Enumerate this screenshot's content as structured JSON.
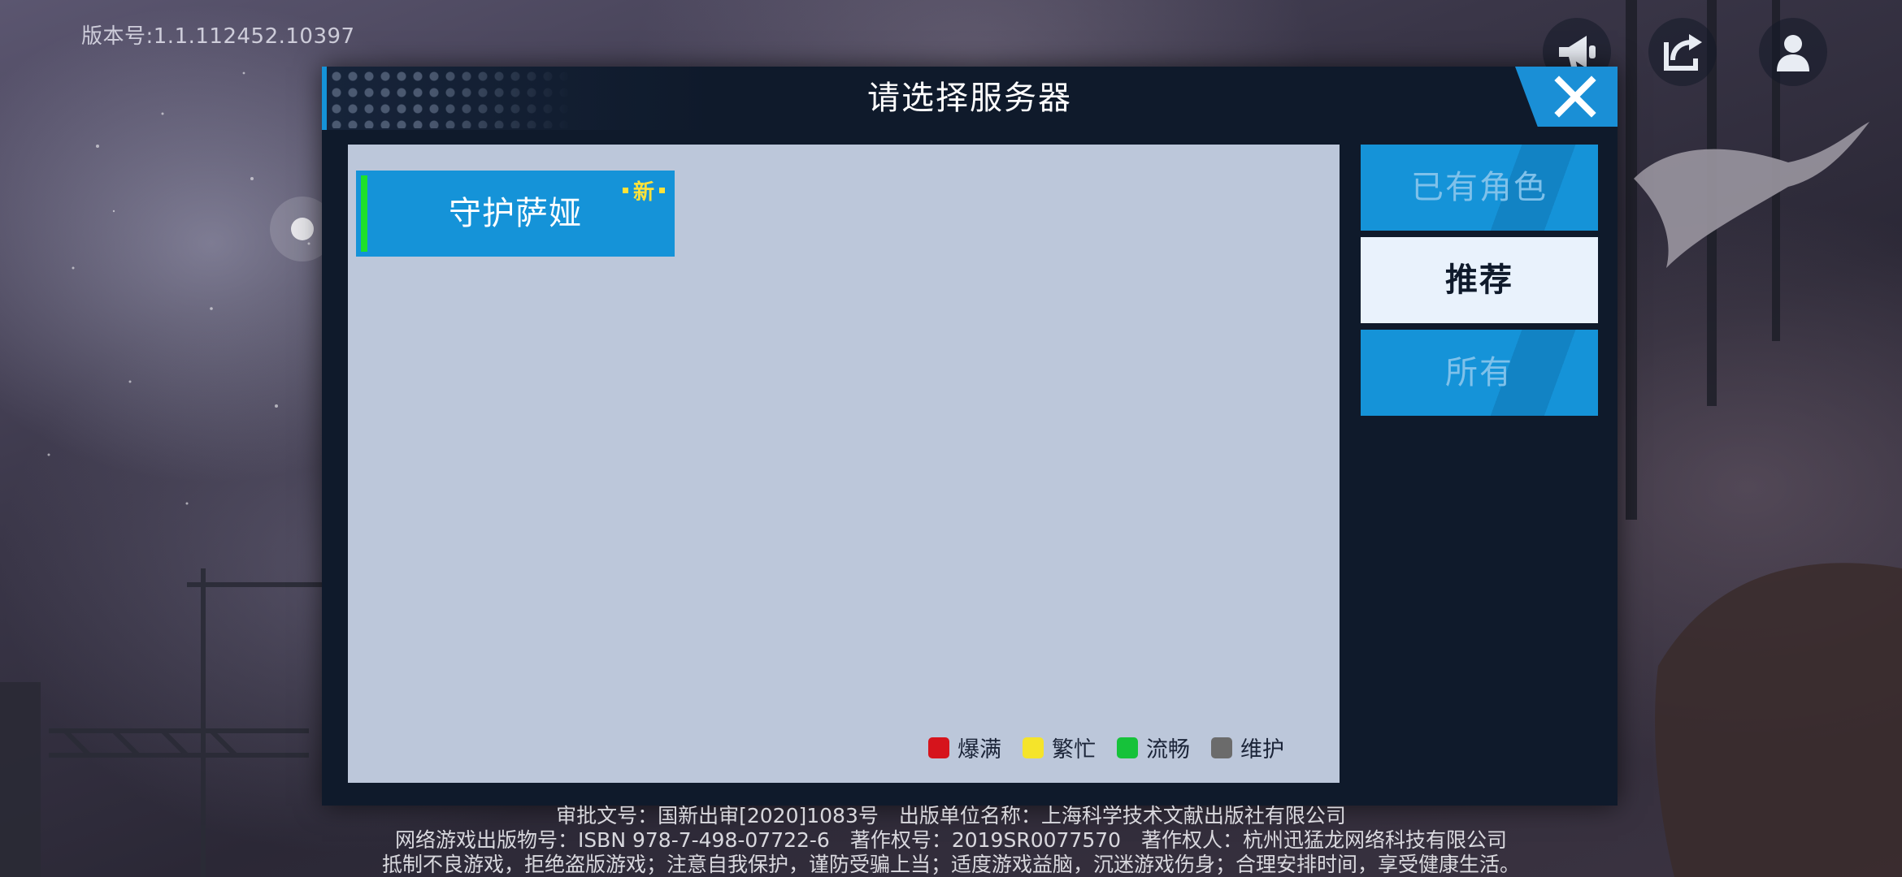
{
  "version_text": "版本号:1.1.112452.10397",
  "top_icons": [
    "announcement-icon",
    "logout-icon",
    "account-icon"
  ],
  "dialog": {
    "title": "请选择服务器",
    "close_icon": "close-icon"
  },
  "servers": [
    {
      "name": "守护萨娅",
      "badge": "新",
      "status": "流畅"
    }
  ],
  "legend": [
    {
      "label": "爆满",
      "color": "#d6141c"
    },
    {
      "label": "繁忙",
      "color": "#f5e42a"
    },
    {
      "label": "流畅",
      "color": "#16c23a"
    },
    {
      "label": "维护",
      "color": "#6b6b6b"
    }
  ],
  "tabs": [
    {
      "label": "已有角色",
      "active": false
    },
    {
      "label": "推荐",
      "active": true
    },
    {
      "label": "所有",
      "active": false
    }
  ],
  "footer": {
    "line1": "审批文号：国新出审[2020]1083号　出版单位名称：上海科学技术文献出版社有限公司",
    "line2": "网络游戏出版物号：ISBN 978-7-498-07722-6　著作权号：2019SR0077570　著作权人：杭州迅猛龙网络科技有限公司",
    "line3": "抵制不良游戏，拒绝盗版游戏；注意自我保护，谨防受骗上当；适度游戏益脑，沉迷游戏伤身；合理安排时间，享受健康生活。"
  },
  "colors": {
    "accent": "#1593d8",
    "panel": "#bcc7da",
    "dialog_bg": "#0f1a2b",
    "active_tab": "#e9f2fc"
  }
}
